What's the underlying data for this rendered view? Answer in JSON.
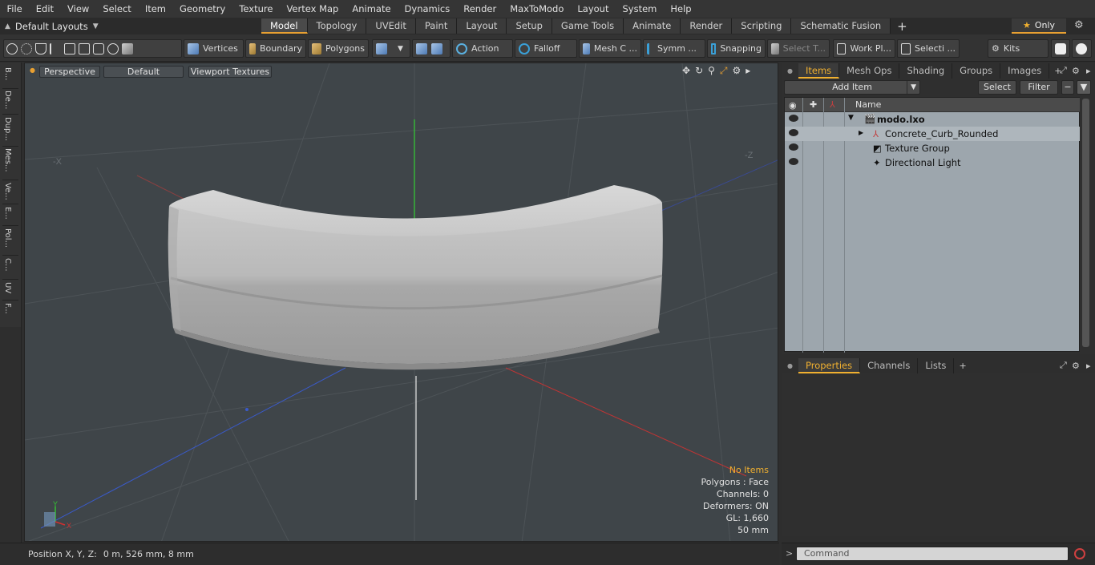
{
  "menu": [
    "File",
    "Edit",
    "View",
    "Select",
    "Item",
    "Geometry",
    "Texture",
    "Vertex Map",
    "Animate",
    "Dynamics",
    "Render",
    "MaxToModo",
    "Layout",
    "System",
    "Help"
  ],
  "layout_selector": "Default Layouts",
  "tabs": [
    "Model",
    "Topology",
    "UVEdit",
    "Paint",
    "Layout",
    "Setup",
    "Game Tools",
    "Animate",
    "Render",
    "Scripting",
    "Schematic Fusion"
  ],
  "active_tab": "Model",
  "only_label": "Only",
  "toolbar": {
    "vertices": "Vertices",
    "boundary": "Boundary",
    "polygons": "Polygons",
    "action": "Action",
    "falloff": "Falloff",
    "mesh": "Mesh C ...",
    "symm": "Symm ...",
    "snapping": "Snapping",
    "select_t": "Select T...",
    "work_pl": "Work Pl...",
    "selecti": "Selecti ...",
    "kits": "Kits"
  },
  "left_strip": [
    "B...",
    "De...",
    "Dup...",
    "Mes...",
    "Ve...",
    "E...",
    "Pol...",
    "C...",
    "UV",
    "F..."
  ],
  "viewport": {
    "perspective": "Perspective",
    "default": "Default",
    "textures": "Viewport Textures",
    "info": {
      "no_items": "No Items",
      "polygons": "Polygons : Face",
      "channels": "Channels: 0",
      "deformers": "Deformers: ON",
      "gl": "GL: 1,660",
      "scale": "50 mm"
    },
    "axis_x": "X",
    "axis_y": "Y",
    "axis_neg_x": "-X",
    "axis_neg_z": "-Z"
  },
  "status": {
    "label": "Position X, Y, Z:",
    "value": "0 m, 526 mm, 8 mm"
  },
  "items_panel": {
    "tabs": [
      "Items",
      "Mesh Ops",
      "Shading",
      "Groups",
      "Images"
    ],
    "add_item": "Add Item",
    "select": "Select",
    "filter": "Filter",
    "name_header": "Name",
    "rows": [
      "modo.lxo",
      "Concrete_Curb_Rounded",
      "Texture Group",
      "Directional Light"
    ]
  },
  "props_panel": {
    "tabs": [
      "Properties",
      "Channels",
      "Lists"
    ]
  },
  "command": {
    "placeholder": "Command"
  }
}
